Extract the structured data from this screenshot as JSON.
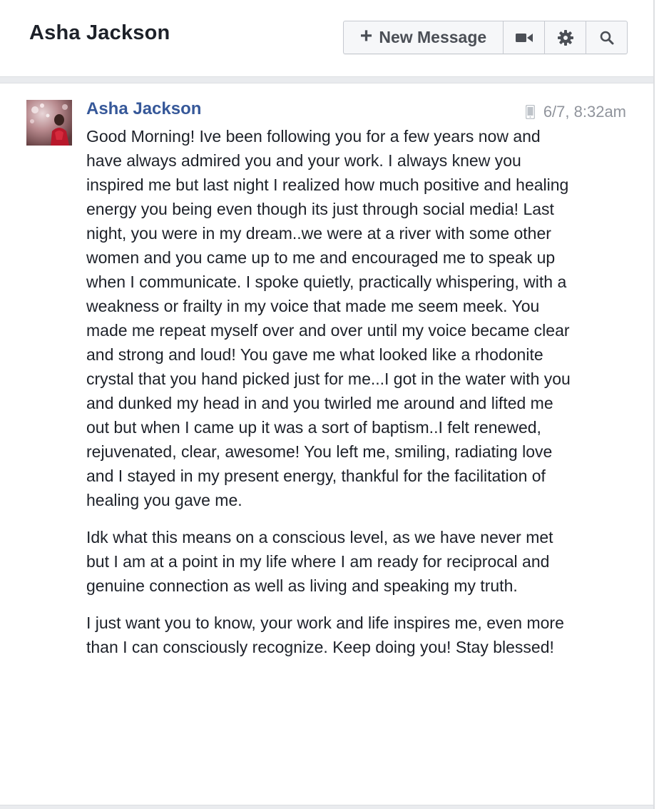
{
  "header": {
    "title": "Asha Jackson",
    "toolbar": {
      "new_message_label": "New Message",
      "new_message_icon": "plus-icon",
      "video_icon": "video-camera-icon",
      "settings_icon": "gear-icon",
      "search_icon": "search-icon"
    }
  },
  "message": {
    "sender": "Asha Jackson",
    "device_icon": "mobile-phone-icon",
    "timestamp": "6/7, 8:32am",
    "paragraphs": [
      "Good Morning! Ive been following you for a few years now and have always admired you and your work. I always knew you inspired me but last night I realized how much positive and healing energy you being even though its just through social media! Last night, you were in my dream..we were at a river with some other women and you came up to me and encouraged me to speak up when I communicate. I spoke quietly, practically whispering, with a weakness or frailty in my voice that made me seem meek. You made me repeat myself over and over until my voice became clear and strong and loud! You gave me what looked like a rhodonite crystal that you hand picked just for me...I got in the water with you and dunked my head in and you twirled me around and lifted me out but when I came up it was a sort of baptism..I felt renewed, rejuvenated, clear, awesome! You left me, smiling, radiating love and I stayed in my present energy, thankful for the facilitation of healing you gave me.",
      "Idk what this means on a conscious level, as we have never met but I am at a point in my life where I am ready for reciprocal and genuine connection as well as living and speaking my truth.",
      "I just want you to know, your work and life inspires me, even more than I can consciously recognize. Keep doing you! Stay blessed!"
    ]
  },
  "colors": {
    "sender_name": "#365899",
    "body_text": "#1d2129",
    "meta_text": "#90949c",
    "toolbar_bg": "#f6f7f9",
    "divider_bg": "#e9ebee"
  }
}
